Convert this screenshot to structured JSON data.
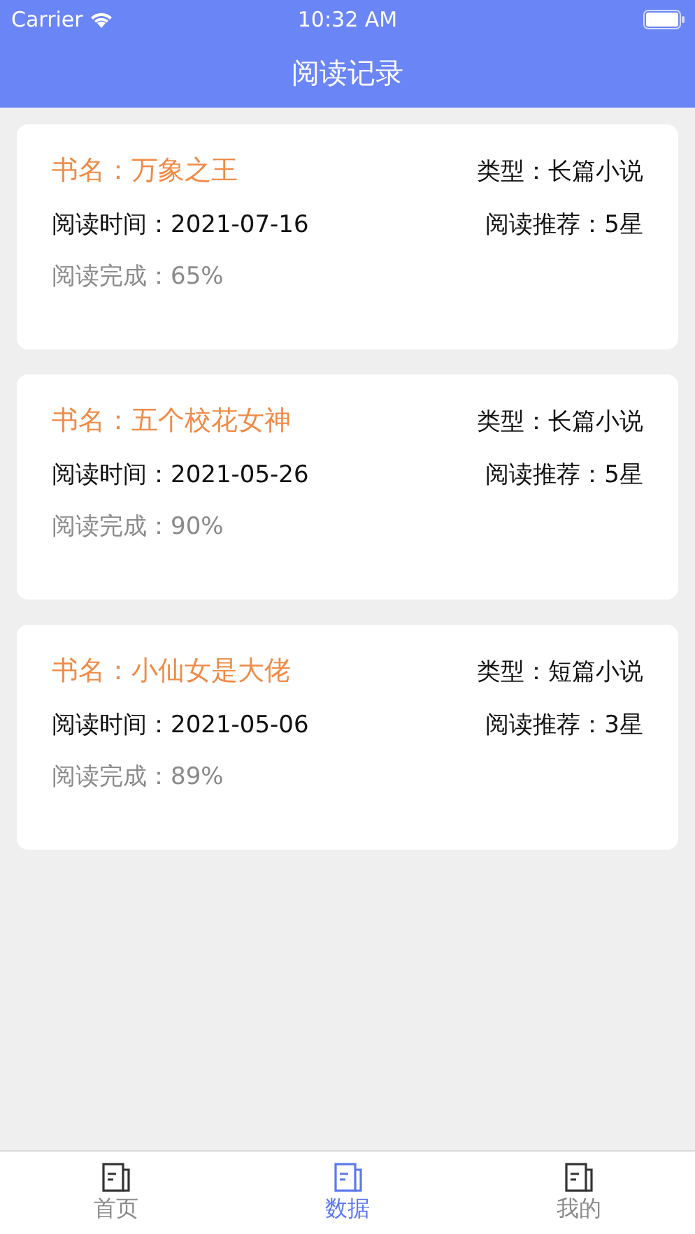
{
  "status_bar": {
    "carrier": "Carrier",
    "time": "10:32 AM"
  },
  "nav_bar": {
    "title": "阅读记录"
  },
  "records": [
    {
      "title": "书名：万象之王",
      "type": "类型：长篇小说",
      "read_time": "阅读时间：2021-07-16",
      "recommend": "阅读推荐：5星",
      "progress": "阅读完成：65%"
    },
    {
      "title": "书名：五个校花女神",
      "type": "类型：长篇小说",
      "read_time": "阅读时间：2021-05-26",
      "recommend": "阅读推荐：5星",
      "progress": "阅读完成：90%"
    },
    {
      "title": "书名：小仙女是大佬",
      "type": "类型：短篇小说",
      "read_time": "阅读时间：2021-05-06",
      "recommend": "阅读推荐：3星",
      "progress": "阅读完成：89%"
    }
  ],
  "tab_bar": [
    {
      "label": "首页",
      "selected": false
    },
    {
      "label": "数据",
      "selected": true
    },
    {
      "label": "我的",
      "selected": false
    }
  ]
}
